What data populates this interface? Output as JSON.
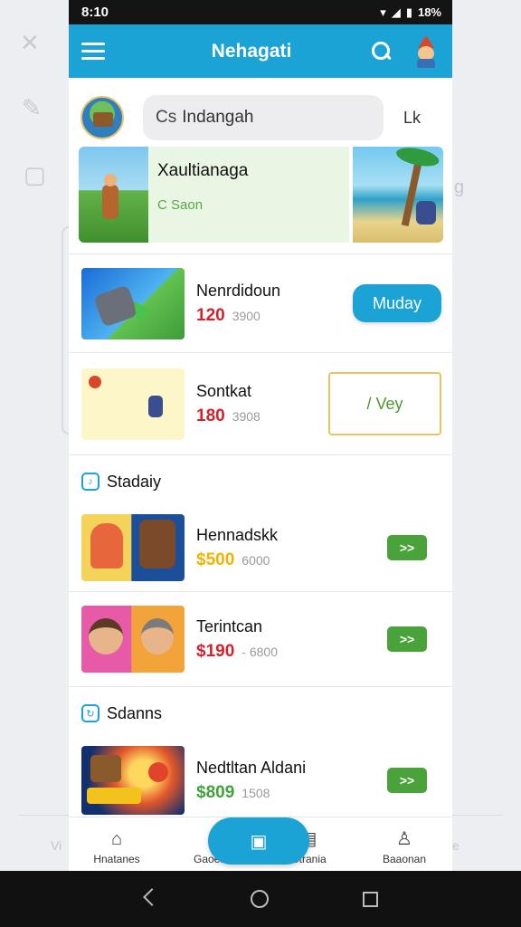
{
  "status": {
    "time": "8:10",
    "battery": "18%"
  },
  "appbar": {
    "title": "Nehagati"
  },
  "search": {
    "prefix": "Cs",
    "value": "Indangah",
    "action": "Lk"
  },
  "banner": {
    "title": "Xaultianaga",
    "subtitle": "C Saon"
  },
  "items": [
    {
      "title": "Nenrdidoun",
      "price": "120",
      "old_price": "3900",
      "button": "Muday"
    },
    {
      "title": "Sontkat",
      "price": "180",
      "old_price": "3908",
      "button": "/ Vey"
    }
  ],
  "section1": {
    "title": "Stadaiy"
  },
  "items2": [
    {
      "title": "Hennadskk",
      "price": "$500",
      "old_price": "6000",
      "button": ">>"
    },
    {
      "title": "Terintcan",
      "price": "$190",
      "old_price": "- 6800",
      "button": ">>"
    }
  ],
  "section2": {
    "title": "Sdanns"
  },
  "items3": [
    {
      "title": "Nedtltan Aldani",
      "price": "$809",
      "old_price": "1508",
      "button": ">>"
    }
  ],
  "bottom_nav": {
    "items": [
      {
        "label": "Hnatanes",
        "icon": "home-icon"
      },
      {
        "label": "Gaoeds",
        "icon": "gamepad-icon"
      },
      {
        "label": "Gtrania",
        "icon": "list-icon"
      },
      {
        "label": "Baaonan",
        "icon": "profile-icon"
      }
    ],
    "fab_icon": "wallet-icon"
  },
  "background": {
    "side_text_left": "Vi",
    "side_text_right": "e"
  },
  "colors": {
    "primary": "#1aa3d4",
    "price_red": "#d3212d",
    "green_button": "#4aa33a",
    "price_yellow": "#f0b400"
  }
}
